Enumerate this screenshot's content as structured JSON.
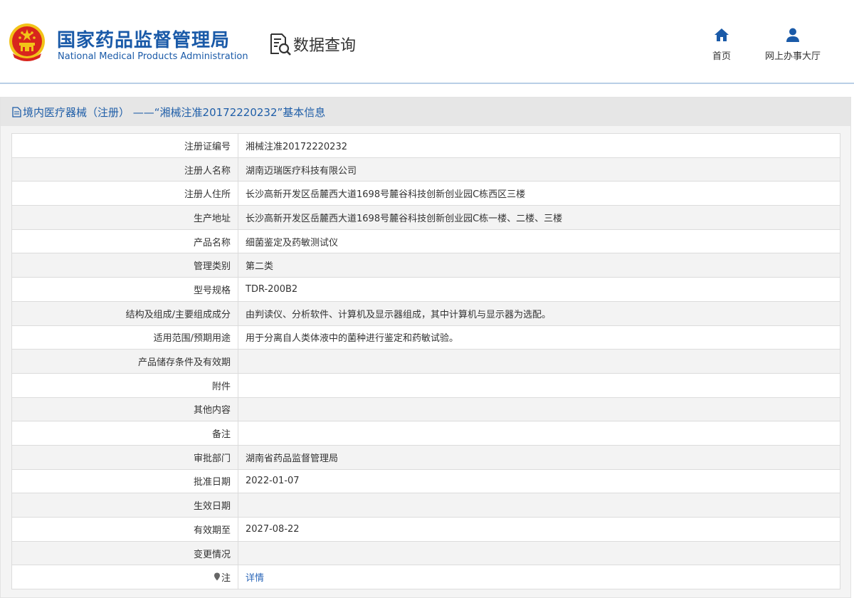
{
  "header": {
    "org_name_cn": "国家药品监督管理局",
    "org_name_en": "National Medical Products Administration",
    "query_label": "数据查询",
    "nav": [
      {
        "label": "首页",
        "icon": "home-icon"
      },
      {
        "label": "网上办事大厅",
        "icon": "user-icon"
      }
    ]
  },
  "panel": {
    "title": "境内医疗器械（注册） ——“湘械注准20172220232”基本信息"
  },
  "rows": [
    {
      "label": "注册证编号",
      "value": "湘械注准20172220232"
    },
    {
      "label": "注册人名称",
      "value": "湖南迈瑞医疗科技有限公司"
    },
    {
      "label": "注册人住所",
      "value": "长沙高新开发区岳麓西大道1698号麓谷科技创新创业园C栋西区三楼"
    },
    {
      "label": "生产地址",
      "value": "长沙高新开发区岳麓西大道1698号麓谷科技创新创业园C栋一楼、二楼、三楼"
    },
    {
      "label": "产品名称",
      "value": "细菌鉴定及药敏测试仪"
    },
    {
      "label": "管理类别",
      "value": "第二类"
    },
    {
      "label": "型号规格",
      "value": "TDR-200B2"
    },
    {
      "label": "结构及组成/主要组成成分",
      "value": "由判读仪、分析软件、计算机及显示器组成，其中计算机与显示器为选配。"
    },
    {
      "label": "适用范围/预期用途",
      "value": "用于分离自人类体液中的菌种进行鉴定和药敏试验。"
    },
    {
      "label": "产品储存条件及有效期",
      "value": ""
    },
    {
      "label": "附件",
      "value": ""
    },
    {
      "label": "其他内容",
      "value": ""
    },
    {
      "label": "备注",
      "value": ""
    },
    {
      "label": "审批部门",
      "value": "湖南省药品监督管理局"
    },
    {
      "label": "批准日期",
      "value": "2022-01-07"
    },
    {
      "label": "生效日期",
      "value": ""
    },
    {
      "label": "有效期至",
      "value": "2027-08-22"
    },
    {
      "label": "变更情况",
      "value": ""
    },
    {
      "label": "注",
      "value": "详情",
      "icon": "pin-icon"
    }
  ],
  "colors": {
    "brand_blue": "#1a5aa8",
    "link_blue": "#2a66b8",
    "emblem_red": "#d8251d",
    "emblem_gold": "#f2c318"
  }
}
